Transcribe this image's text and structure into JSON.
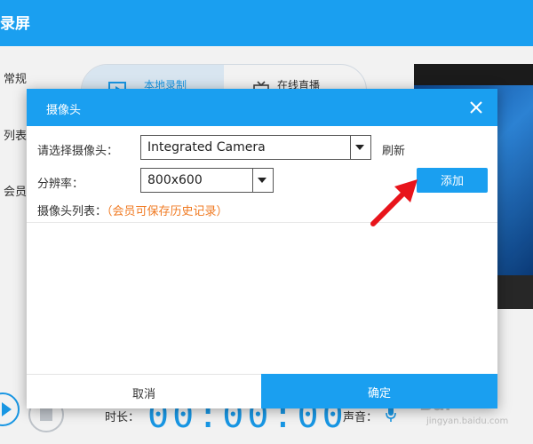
{
  "app": {
    "title": "录屏"
  },
  "sidebar": {
    "items": [
      {
        "label": "常规"
      },
      {
        "label": "列表"
      },
      {
        "label": "会员"
      }
    ]
  },
  "mode_tabs": [
    {
      "label": "本地录制",
      "icon": "local-record-icon",
      "active": true
    },
    {
      "label": "在线直播",
      "icon": "tv-icon",
      "active": false
    }
  ],
  "bottom": {
    "duration_label": "时长：",
    "duration_value": "00:00:00",
    "sound_label": "声音："
  },
  "watermark": {
    "text": "Bai",
    "sub": "jingyan.baidu.com"
  },
  "dialog": {
    "title": "摄像头",
    "camera_label": "请选择摄像头：",
    "camera_value": "Integrated Camera",
    "refresh_label": "刷新",
    "resolution_label": "分辨率：",
    "resolution_value": "800x600",
    "add_label": "添加",
    "list_label": "摄像头列表：",
    "list_hint": "（会员可保存历史记录）",
    "cancel_label": "取消",
    "confirm_label": "确定"
  },
  "colors": {
    "accent": "#1a9ff0",
    "hint": "#f07a22",
    "annotation_arrow": "#e8141b"
  }
}
